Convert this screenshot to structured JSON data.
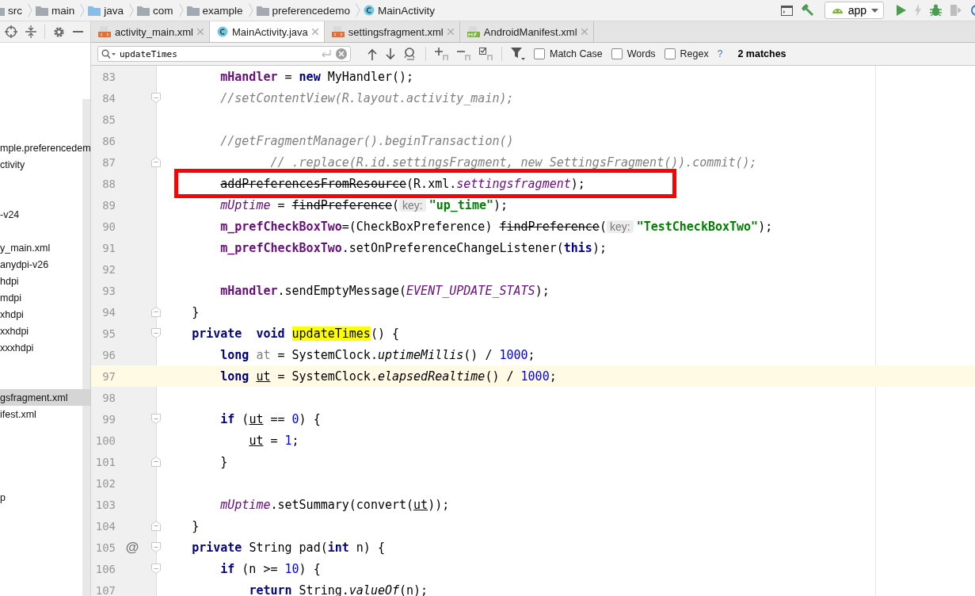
{
  "breadcrumbs": [
    {
      "label": "src",
      "kind": "folder"
    },
    {
      "label": "main",
      "kind": "folder"
    },
    {
      "label": "java",
      "kind": "source-folder"
    },
    {
      "label": "com",
      "kind": "folder"
    },
    {
      "label": "example",
      "kind": "folder"
    },
    {
      "label": "preferencedemo",
      "kind": "folder"
    },
    {
      "label": "MainActivity",
      "kind": "class"
    }
  ],
  "run_config": {
    "label": "app"
  },
  "tabs": [
    {
      "label": "activity_main.xml",
      "kind": "xml",
      "selected": false
    },
    {
      "label": "MainActivity.java",
      "kind": "class",
      "selected": true
    },
    {
      "label": "settingsfragment.xml",
      "kind": "xml",
      "selected": false
    },
    {
      "label": "AndroidManifest.xml",
      "kind": "manifest",
      "selected": false
    }
  ],
  "project_tree": [
    {
      "label": "mple.preferencedem",
      "selected": false
    },
    {
      "label": "ctivity",
      "selected": false
    },
    {
      "selected": false
    },
    {
      "selected": false
    },
    {
      "label": "-v24",
      "selected": false
    },
    {
      "selected": false
    },
    {
      "label": "y_main.xml",
      "selected": false
    },
    {
      "label": "anydpi-v26",
      "selected": false
    },
    {
      "label": "hdpi",
      "selected": false
    },
    {
      "label": "mdpi",
      "selected": false
    },
    {
      "label": "xhdpi",
      "selected": false
    },
    {
      "label": "xxhdpi",
      "selected": false
    },
    {
      "label": "xxxhdpi",
      "selected": false
    },
    {
      "selected": false
    },
    {
      "selected": false
    },
    {
      "label": "gsfragment.xml",
      "selected": true
    },
    {
      "label": "ifest.xml",
      "selected": false
    },
    {
      "selected": false
    },
    {
      "selected": false
    },
    {
      "selected": false
    },
    {
      "selected": false
    },
    {
      "label": "p",
      "selected": false
    }
  ],
  "find_bar": {
    "value": "updateTimes",
    "options": [
      {
        "label": "Match Case",
        "checked": false
      },
      {
        "label": "Words",
        "checked": false
      },
      {
        "label": "Regex",
        "checked": false
      }
    ],
    "help": "?",
    "result": "2 matches"
  },
  "editor": {
    "lines": [
      {
        "number": "83",
        "current": false,
        "boxed": false,
        "tokens": [
          {
            "text": "        mHandler",
            "kind": "field"
          },
          {
            "text": " = ",
            "kind": "plain"
          },
          {
            "text": "new",
            "kind": "kw"
          },
          {
            "text": " MyHandler();",
            "kind": "plain"
          }
        ]
      },
      {
        "number": "84",
        "current": false,
        "boxed": false,
        "fold": {
          "kind": "start"
        },
        "tokens": [
          {
            "text": "        //setContentView(R.layout.activity_main);",
            "kind": "comment"
          }
        ]
      },
      {
        "number": "85",
        "current": false,
        "boxed": false
      },
      {
        "number": "86",
        "current": false,
        "boxed": false,
        "tokens": [
          {
            "text": "        //getFragmentManager().beginTransaction()",
            "kind": "comment"
          }
        ]
      },
      {
        "number": "87",
        "current": false,
        "boxed": false,
        "fold": {
          "kind": "end"
        },
        "tokens": [
          {
            "text": "               // .replace(R.id.settingsFragment, new SettingsFragment()).commit();",
            "kind": "comment"
          }
        ]
      },
      {
        "number": "88",
        "current": false,
        "boxed": true,
        "tokens": [
          {
            "text": "        addPreferencesFromResource",
            "kind": "deprecated"
          },
          {
            "text": "(R.xml.",
            "kind": "plain"
          },
          {
            "text": "settingsfragment",
            "kind": "static"
          },
          {
            "text": ");",
            "kind": "plain"
          }
        ]
      },
      {
        "number": "89",
        "current": false,
        "boxed": false,
        "tokens": [
          {
            "text": "        mUptime",
            "kind": "static"
          },
          {
            "text": " = ",
            "kind": "plain"
          },
          {
            "text": "findPreference",
            "kind": "deprecated"
          },
          {
            "text": "(",
            "kind": "plain"
          },
          {
            "text": "key:",
            "kind": "hint"
          },
          {
            "text": "\"up_time\"",
            "kind": "string"
          },
          {
            "text": ");",
            "kind": "plain"
          }
        ]
      },
      {
        "number": "90",
        "current": false,
        "boxed": false,
        "tokens": [
          {
            "text": "        m_prefCheckBoxTwo",
            "kind": "field"
          },
          {
            "text": "=(CheckBoxPreference) ",
            "kind": "plain"
          },
          {
            "text": "findPreference",
            "kind": "deprecated"
          },
          {
            "text": "(",
            "kind": "plain"
          },
          {
            "text": "key:",
            "kind": "hint"
          },
          {
            "text": "\"TestCheckBoxTwo\"",
            "kind": "string"
          },
          {
            "text": ");",
            "kind": "plain"
          }
        ]
      },
      {
        "number": "91",
        "current": false,
        "boxed": false,
        "tokens": [
          {
            "text": "        m_prefCheckBoxTwo",
            "kind": "field"
          },
          {
            "text": ".setOnPreferenceChangeListener(",
            "kind": "plain"
          },
          {
            "text": "this",
            "kind": "kw"
          },
          {
            "text": ");",
            "kind": "plain"
          }
        ]
      },
      {
        "number": "92",
        "current": false,
        "boxed": false
      },
      {
        "number": "93",
        "current": false,
        "boxed": false,
        "tokens": [
          {
            "text": "        mHandler",
            "kind": "field"
          },
          {
            "text": ".sendEmptyMessage(",
            "kind": "plain"
          },
          {
            "text": "EVENT_UPDATE_STATS",
            "kind": "static"
          },
          {
            "text": ");",
            "kind": "plain"
          }
        ]
      },
      {
        "number": "94",
        "current": false,
        "boxed": false,
        "fold": {
          "kind": "end"
        },
        "tokens": [
          {
            "text": "    }",
            "kind": "plain"
          }
        ]
      },
      {
        "number": "95",
        "current": false,
        "boxed": false,
        "fold": {
          "kind": "start"
        },
        "tokens": [
          {
            "text": "    private  void ",
            "kind": "kw"
          },
          {
            "text": "updateTimes",
            "kind": "match"
          },
          {
            "text": "() {",
            "kind": "plain"
          }
        ]
      },
      {
        "number": "96",
        "current": false,
        "boxed": false,
        "tokens": [
          {
            "text": "        long ",
            "kind": "kw"
          },
          {
            "text": "at",
            "kind": "unused"
          },
          {
            "text": " = SystemClock.",
            "kind": "plain"
          },
          {
            "text": "uptimeMillis",
            "kind": "italic"
          },
          {
            "text": "() / ",
            "kind": "plain"
          },
          {
            "text": "1000",
            "kind": "num"
          },
          {
            "text": ";",
            "kind": "plain"
          }
        ]
      },
      {
        "number": "97",
        "current": true,
        "boxed": false,
        "tokens": [
          {
            "text": "        long ",
            "kind": "kw"
          },
          {
            "text": "ut",
            "kind": "ref"
          },
          {
            "text": " = SystemClock.",
            "kind": "plain"
          },
          {
            "text": "elapsedRealtime",
            "kind": "italic"
          },
          {
            "text": "() / ",
            "kind": "plain"
          },
          {
            "text": "1000",
            "kind": "num"
          },
          {
            "text": ";",
            "kind": "plain"
          }
        ]
      },
      {
        "number": "98",
        "current": false,
        "boxed": false
      },
      {
        "number": "99",
        "current": false,
        "boxed": false,
        "fold": {
          "kind": "start"
        },
        "tokens": [
          {
            "text": "        if",
            "kind": "kw"
          },
          {
            "text": " (",
            "kind": "plain"
          },
          {
            "text": "ut",
            "kind": "ref"
          },
          {
            "text": " == ",
            "kind": "plain"
          },
          {
            "text": "0",
            "kind": "num"
          },
          {
            "text": ") {",
            "kind": "plain"
          }
        ]
      },
      {
        "number": "100",
        "current": false,
        "boxed": false,
        "tokens": [
          {
            "text": "            ut",
            "kind": "ref"
          },
          {
            "text": " = ",
            "kind": "plain"
          },
          {
            "text": "1",
            "kind": "num"
          },
          {
            "text": ";",
            "kind": "plain"
          }
        ]
      },
      {
        "number": "101",
        "current": false,
        "boxed": false,
        "fold": {
          "kind": "end"
        },
        "tokens": [
          {
            "text": "        }",
            "kind": "plain"
          }
        ]
      },
      {
        "number": "102",
        "current": false,
        "boxed": false
      },
      {
        "number": "103",
        "current": false,
        "boxed": false,
        "tokens": [
          {
            "text": "        mUptime",
            "kind": "static"
          },
          {
            "text": ".setSummary(convert(",
            "kind": "plain"
          },
          {
            "text": "ut",
            "kind": "ref"
          },
          {
            "text": "));",
            "kind": "plain"
          }
        ]
      },
      {
        "number": "104",
        "current": false,
        "boxed": false,
        "fold": {
          "kind": "end"
        },
        "tokens": [
          {
            "text": "    }",
            "kind": "plain"
          }
        ]
      },
      {
        "number": "105",
        "current": false,
        "boxed": false,
        "fold": {
          "kind": "start"
        },
        "gutter_mark": "@",
        "tokens": [
          {
            "text": "    private",
            "kind": "kw"
          },
          {
            "text": " String pad(",
            "kind": "plain"
          },
          {
            "text": "int",
            "kind": "kw"
          },
          {
            "text": " n) {",
            "kind": "plain"
          }
        ]
      },
      {
        "number": "106",
        "current": false,
        "boxed": false,
        "fold": {
          "kind": "start"
        },
        "tokens": [
          {
            "text": "        if",
            "kind": "kw"
          },
          {
            "text": " (n >= ",
            "kind": "plain"
          },
          {
            "text": "10",
            "kind": "num"
          },
          {
            "text": ") {",
            "kind": "plain"
          }
        ]
      },
      {
        "number": "107",
        "current": false,
        "boxed": false,
        "tokens": [
          {
            "text": "            return",
            "kind": "kw"
          },
          {
            "text": " String.",
            "kind": "plain"
          },
          {
            "text": "valueOf",
            "kind": "italic"
          },
          {
            "text": "(n);",
            "kind": "plain"
          }
        ]
      }
    ]
  }
}
